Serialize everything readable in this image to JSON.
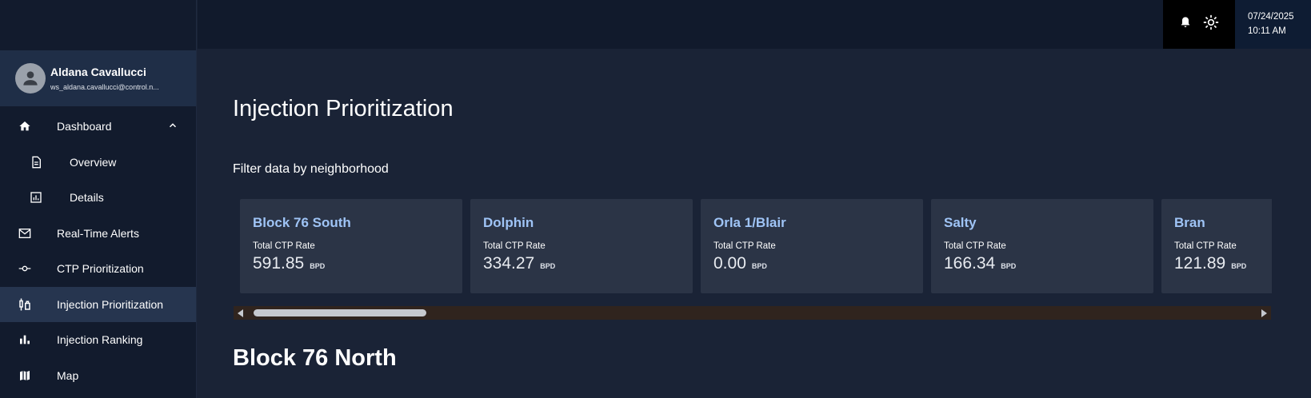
{
  "user": {
    "name": "Aldana Cavallucci",
    "email": "ws_aldana.cavallucci@control.n..."
  },
  "nav": {
    "dashboard": "Dashboard",
    "overview": "Overview",
    "details": "Details",
    "realtime_alerts": "Real-Time Alerts",
    "ctp_prioritization": "CTP Prioritization",
    "injection_prioritization": "Injection Prioritization",
    "injection_ranking": "Injection Ranking",
    "map": "Map"
  },
  "topbar": {
    "date": "07/24/2025",
    "time": "10:11 AM"
  },
  "main": {
    "title": "Injection Prioritization",
    "filter_label": "Filter data by neighborhood",
    "section_title": "Block 76 North",
    "cards": [
      {
        "name": "Block 76 South",
        "metric": "Total CTP Rate",
        "value": "591.85",
        "unit": "BPD"
      },
      {
        "name": "Dolphin",
        "metric": "Total CTP Rate",
        "value": "334.27",
        "unit": "BPD"
      },
      {
        "name": "Orla 1/Blair",
        "metric": "Total CTP Rate",
        "value": "0.00",
        "unit": "BPD"
      },
      {
        "name": "Salty",
        "metric": "Total CTP Rate",
        "value": "166.34",
        "unit": "BPD"
      },
      {
        "name": "Bran",
        "metric": "Total CTP Rate",
        "value": "121.89",
        "unit": "BPD"
      }
    ]
  },
  "colors": {
    "background": "#1a2336",
    "sidebar": "#121b2d",
    "card": "#2b3446",
    "card_title": "#9fc4f6",
    "active_nav": "#26354f"
  },
  "icons": {
    "dashboard": "home-icon",
    "overview": "document-icon",
    "details": "bar-chart-box-icon",
    "alerts": "mail-icon",
    "ctp": "commit-icon",
    "injection": "injection-icon",
    "ranking": "bar-chart-icon",
    "map": "map-icon",
    "bell": "bell-icon",
    "theme": "sun-icon"
  }
}
